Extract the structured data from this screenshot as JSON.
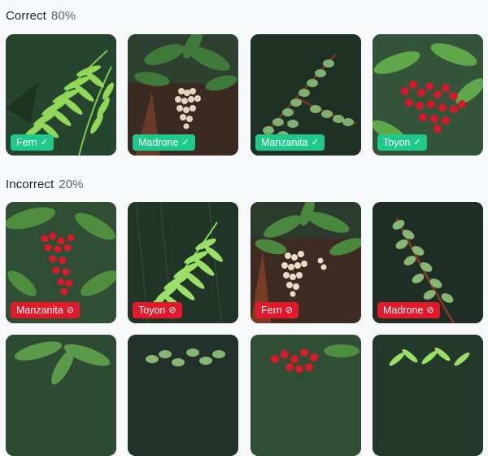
{
  "correct": {
    "label": "Correct",
    "percent": "80%",
    "items": [
      {
        "name": "Fern",
        "mark": "✓"
      },
      {
        "name": "Madrone",
        "mark": "✓"
      },
      {
        "name": "Manzanita",
        "mark": "✓"
      },
      {
        "name": "Toyon",
        "mark": "✓"
      }
    ]
  },
  "incorrect": {
    "label": "Incorrect",
    "percent": "20%",
    "items": [
      {
        "name": "Manzanita",
        "mark": "⊘"
      },
      {
        "name": "Toyon",
        "mark": "⊘"
      },
      {
        "name": "Fern",
        "mark": "⊘"
      },
      {
        "name": "Madrone",
        "mark": "⊘"
      }
    ]
  },
  "colors": {
    "correct_tag": "#1ec98c",
    "incorrect_tag": "#e3192b"
  }
}
